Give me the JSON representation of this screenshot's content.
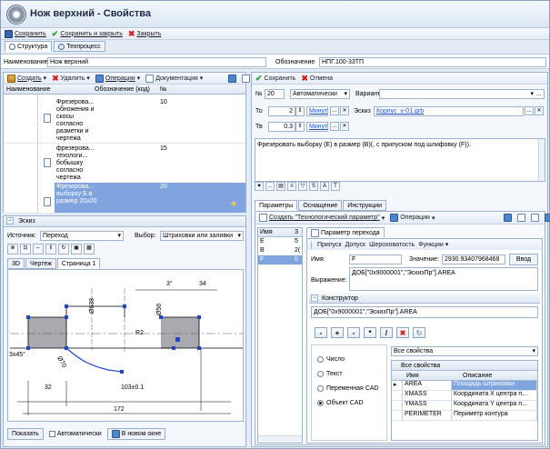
{
  "window": {
    "title": "Нож верхний - Свойства"
  },
  "main_toolbar": {
    "save": "Сохранить",
    "save_close": "Сохранить и закрыть",
    "close": "Закрыть"
  },
  "top_tabs": [
    {
      "label": "Структура"
    },
    {
      "label": "Техпроцесс"
    }
  ],
  "header": {
    "name_label": "Наименование",
    "name_value": "Нож верхний",
    "designation_label": "Обозначение",
    "designation_value": "НПГ.100-33ТП"
  },
  "tree_toolbar": {
    "create": "Создать",
    "delete": "Удалить",
    "operations": "Операции",
    "documentation": "Документация"
  },
  "tree": {
    "columns": [
      "Наименование",
      "Обозначение (код)",
      "№"
    ],
    "rows": [
      {
        "text": "Фрезерова... обножения и скосы согласно разметки и чертежа",
        "code": "",
        "num": "10",
        "selected": false
      },
      {
        "text": "фрезерова... техологи... бобышку согласно чертежа",
        "code": "",
        "num": "15",
        "selected": false
      },
      {
        "text": "Фрезерова... выборку Б в размер 20х20.",
        "code": "",
        "num": "20",
        "selected": true
      }
    ]
  },
  "sketch": {
    "title": "Эскиз",
    "source_label": "Источник:",
    "source_value": "Переход",
    "choice_label": "Выбор:",
    "choice_value": "Штриховки или заливки",
    "tabs": [
      "3D",
      "Чертеж",
      "Страница 1"
    ],
    "active_tab": "Страница 1",
    "dims": {
      "d1": "3°",
      "d2": "34",
      "d3": "Ø638",
      "d4": "Ø56",
      "d5": "R2",
      "d6": "3х45°",
      "d7": "32",
      "d8": "103±0.1",
      "d9": "172",
      "d10": "Ø70"
    },
    "show_btn": "Показать",
    "auto_label": "Автоматически",
    "new_window": "В новом окне"
  },
  "right_toolbar": {
    "save": "Сохранить",
    "cancel": "Отмена"
  },
  "step": {
    "num_label": "№",
    "num_value": "20",
    "mode_value": "Автоматически",
    "variant_label": "Вариант",
    "variant_value": "",
    "to_label": "То",
    "to_value": "2",
    "to_unit": "Минута",
    "tv_label": "Тв",
    "tv_value": "0.3",
    "tv_unit": "Минута",
    "sketch_label": "Эскиз",
    "sketch_link": "Корпус_v-01.grb",
    "description": "Фрезеровать выборку (Е) в размер (В)(, с припуском под шлифовку (F))."
  },
  "lower_tabs": [
    "Параметры",
    "Оснащение",
    "Инструкции"
  ],
  "params": {
    "create": "Создать \"Технологический параметр\"",
    "operations": "Операции",
    "sub_tab": "Параметр перехода",
    "list_header": [
      "Имя",
      "З"
    ],
    "list": [
      {
        "name": "E",
        "val": "5"
      },
      {
        "name": "B",
        "val": "2("
      },
      {
        "name": "F",
        "val": "0"
      }
    ],
    "sub_toolbar": [
      "Припуск",
      "Допуск",
      "Шероховатость",
      "Функции"
    ],
    "name_label": "Имя:",
    "name_value": "F",
    "value_label": "Значение:",
    "value_value": "2930.93407968468",
    "enter_btn": "Ввод",
    "expr_label": "Выражение:",
    "expr_value": "ДОБ[\"0х9000001\",\"ЭскизПр\"].AREA",
    "constructor_title": "Конструктор",
    "constructor_value": "ДОБ[\"0х9000001\",\"ЭскизПр\"].AREA",
    "ops": [
      "-",
      "+",
      "-",
      "*",
      "/"
    ],
    "radios": [
      {
        "label": "Число",
        "on": false
      },
      {
        "label": "Текст",
        "on": false
      },
      {
        "label": "Переменная CAD",
        "on": false
      },
      {
        "label": "Объект CAD",
        "on": true
      }
    ],
    "props_select": "Все свойства",
    "props_title": "Все свойства",
    "props_cols": [
      "Имя",
      "Описание"
    ],
    "props": [
      {
        "name": "AREA",
        "desc": "Площадь штриховки",
        "sel": true
      },
      {
        "name": "XMASS",
        "desc": "Координата X центра п...",
        "sel": false
      },
      {
        "name": "YMASS",
        "desc": "Координата Y центра п...",
        "sel": false
      },
      {
        "name": "PERIMETER",
        "desc": "Периметр контура",
        "sel": false
      }
    ]
  }
}
